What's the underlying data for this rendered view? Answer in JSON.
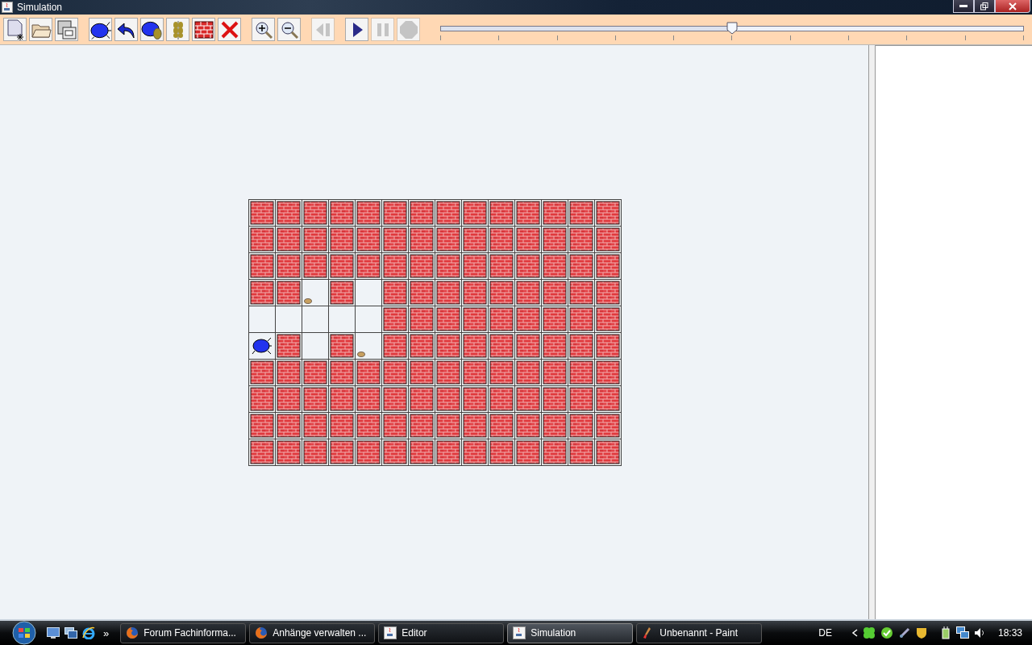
{
  "window": {
    "title": "Simulation"
  },
  "toolbar_groups": [
    [
      {
        "kind": "new",
        "disabled": false
      },
      {
        "kind": "open",
        "disabled": false
      },
      {
        "kind": "save",
        "disabled": false
      }
    ],
    [
      {
        "kind": "bug",
        "disabled": false
      },
      {
        "kind": "turn",
        "disabled": false
      },
      {
        "kind": "bug-grain",
        "disabled": false
      },
      {
        "kind": "grain",
        "disabled": false
      },
      {
        "kind": "wall",
        "disabled": false
      },
      {
        "kind": "delete",
        "disabled": false
      }
    ],
    [
      {
        "kind": "zoom-in",
        "disabled": false
      },
      {
        "kind": "zoom-out",
        "disabled": false
      }
    ],
    [
      {
        "kind": "step-back",
        "disabled": true
      }
    ],
    [
      {
        "kind": "play",
        "disabled": false
      },
      {
        "kind": "pause",
        "disabled": true
      },
      {
        "kind": "stop",
        "disabled": true
      }
    ]
  ],
  "speed_slider": {
    "level": 0.5
  },
  "grid": [
    [
      {
        "kind": "wall"
      },
      {
        "kind": "wall"
      },
      {
        "kind": "wall"
      },
      {
        "kind": "wall"
      },
      {
        "kind": "wall"
      },
      {
        "kind": "wall"
      },
      {
        "kind": "wall"
      },
      {
        "kind": "wall"
      },
      {
        "kind": "wall"
      },
      {
        "kind": "wall"
      },
      {
        "kind": "wall"
      },
      {
        "kind": "wall"
      },
      {
        "kind": "wall"
      },
      {
        "kind": "wall"
      }
    ],
    [
      {
        "kind": "wall"
      },
      {
        "kind": "wall"
      },
      {
        "kind": "wall"
      },
      {
        "kind": "wall"
      },
      {
        "kind": "wall"
      },
      {
        "kind": "wall"
      },
      {
        "kind": "wall"
      },
      {
        "kind": "wall"
      },
      {
        "kind": "wall"
      },
      {
        "kind": "wall"
      },
      {
        "kind": "wall"
      },
      {
        "kind": "wall"
      },
      {
        "kind": "wall"
      },
      {
        "kind": "wall"
      }
    ],
    [
      {
        "kind": "wall"
      },
      {
        "kind": "wall"
      },
      {
        "kind": "wall"
      },
      {
        "kind": "wall"
      },
      {
        "kind": "wall"
      },
      {
        "kind": "wall"
      },
      {
        "kind": "wall"
      },
      {
        "kind": "wall"
      },
      {
        "kind": "wall"
      },
      {
        "kind": "wall"
      },
      {
        "kind": "wall"
      },
      {
        "kind": "wall"
      },
      {
        "kind": "wall"
      },
      {
        "kind": "wall"
      }
    ],
    [
      {
        "kind": "wall"
      },
      {
        "kind": "wall"
      },
      {
        "kind": "grain"
      },
      {
        "kind": "wall"
      },
      {
        "kind": "empty"
      },
      {
        "kind": "wall"
      },
      {
        "kind": "wall"
      },
      {
        "kind": "wall"
      },
      {
        "kind": "wall"
      },
      {
        "kind": "wall"
      },
      {
        "kind": "wall"
      },
      {
        "kind": "wall"
      },
      {
        "kind": "wall"
      },
      {
        "kind": "wall"
      }
    ],
    [
      {
        "kind": "empty"
      },
      {
        "kind": "empty"
      },
      {
        "kind": "empty"
      },
      {
        "kind": "empty"
      },
      {
        "kind": "empty"
      },
      {
        "kind": "wall"
      },
      {
        "kind": "wall"
      },
      {
        "kind": "wall"
      },
      {
        "kind": "wall"
      },
      {
        "kind": "wall"
      },
      {
        "kind": "wall"
      },
      {
        "kind": "wall"
      },
      {
        "kind": "wall"
      },
      {
        "kind": "wall"
      }
    ],
    [
      {
        "kind": "bug"
      },
      {
        "kind": "wall"
      },
      {
        "kind": "empty"
      },
      {
        "kind": "wall"
      },
      {
        "kind": "grain"
      },
      {
        "kind": "wall"
      },
      {
        "kind": "wall"
      },
      {
        "kind": "wall"
      },
      {
        "kind": "wall"
      },
      {
        "kind": "wall"
      },
      {
        "kind": "wall"
      },
      {
        "kind": "wall"
      },
      {
        "kind": "wall"
      },
      {
        "kind": "wall"
      }
    ],
    [
      {
        "kind": "wall"
      },
      {
        "kind": "wall"
      },
      {
        "kind": "wall"
      },
      {
        "kind": "wall"
      },
      {
        "kind": "wall"
      },
      {
        "kind": "wall"
      },
      {
        "kind": "wall"
      },
      {
        "kind": "wall"
      },
      {
        "kind": "wall"
      },
      {
        "kind": "wall"
      },
      {
        "kind": "wall"
      },
      {
        "kind": "wall"
      },
      {
        "kind": "wall"
      },
      {
        "kind": "wall"
      }
    ],
    [
      {
        "kind": "wall"
      },
      {
        "kind": "wall"
      },
      {
        "kind": "wall"
      },
      {
        "kind": "wall"
      },
      {
        "kind": "wall"
      },
      {
        "kind": "wall"
      },
      {
        "kind": "wall"
      },
      {
        "kind": "wall"
      },
      {
        "kind": "wall"
      },
      {
        "kind": "wall"
      },
      {
        "kind": "wall"
      },
      {
        "kind": "wall"
      },
      {
        "kind": "wall"
      },
      {
        "kind": "wall"
      }
    ],
    [
      {
        "kind": "wall"
      },
      {
        "kind": "wall"
      },
      {
        "kind": "wall"
      },
      {
        "kind": "wall"
      },
      {
        "kind": "wall"
      },
      {
        "kind": "wall"
      },
      {
        "kind": "wall"
      },
      {
        "kind": "wall"
      },
      {
        "kind": "wall"
      },
      {
        "kind": "wall"
      },
      {
        "kind": "wall"
      },
      {
        "kind": "wall"
      },
      {
        "kind": "wall"
      },
      {
        "kind": "wall"
      }
    ],
    [
      {
        "kind": "wall"
      },
      {
        "kind": "wall"
      },
      {
        "kind": "wall"
      },
      {
        "kind": "wall"
      },
      {
        "kind": "wall"
      },
      {
        "kind": "wall"
      },
      {
        "kind": "wall"
      },
      {
        "kind": "wall"
      },
      {
        "kind": "wall"
      },
      {
        "kind": "wall"
      },
      {
        "kind": "wall"
      },
      {
        "kind": "wall"
      },
      {
        "kind": "wall"
      },
      {
        "kind": "wall"
      }
    ]
  ],
  "taskbar": {
    "overflow": "»",
    "tasks": [
      {
        "label": "Forum Fachinforma...",
        "kind": "firefox",
        "selected": false
      },
      {
        "label": "Anhänge verwalten ...",
        "kind": "firefox",
        "selected": false
      },
      {
        "label": "Editor",
        "kind": "java",
        "selected": false
      },
      {
        "label": "Simulation",
        "kind": "java",
        "selected": true
      },
      {
        "label": "Unbenannt - Paint",
        "kind": "paint",
        "selected": false
      }
    ],
    "language": "DE",
    "clock": "18:33"
  }
}
